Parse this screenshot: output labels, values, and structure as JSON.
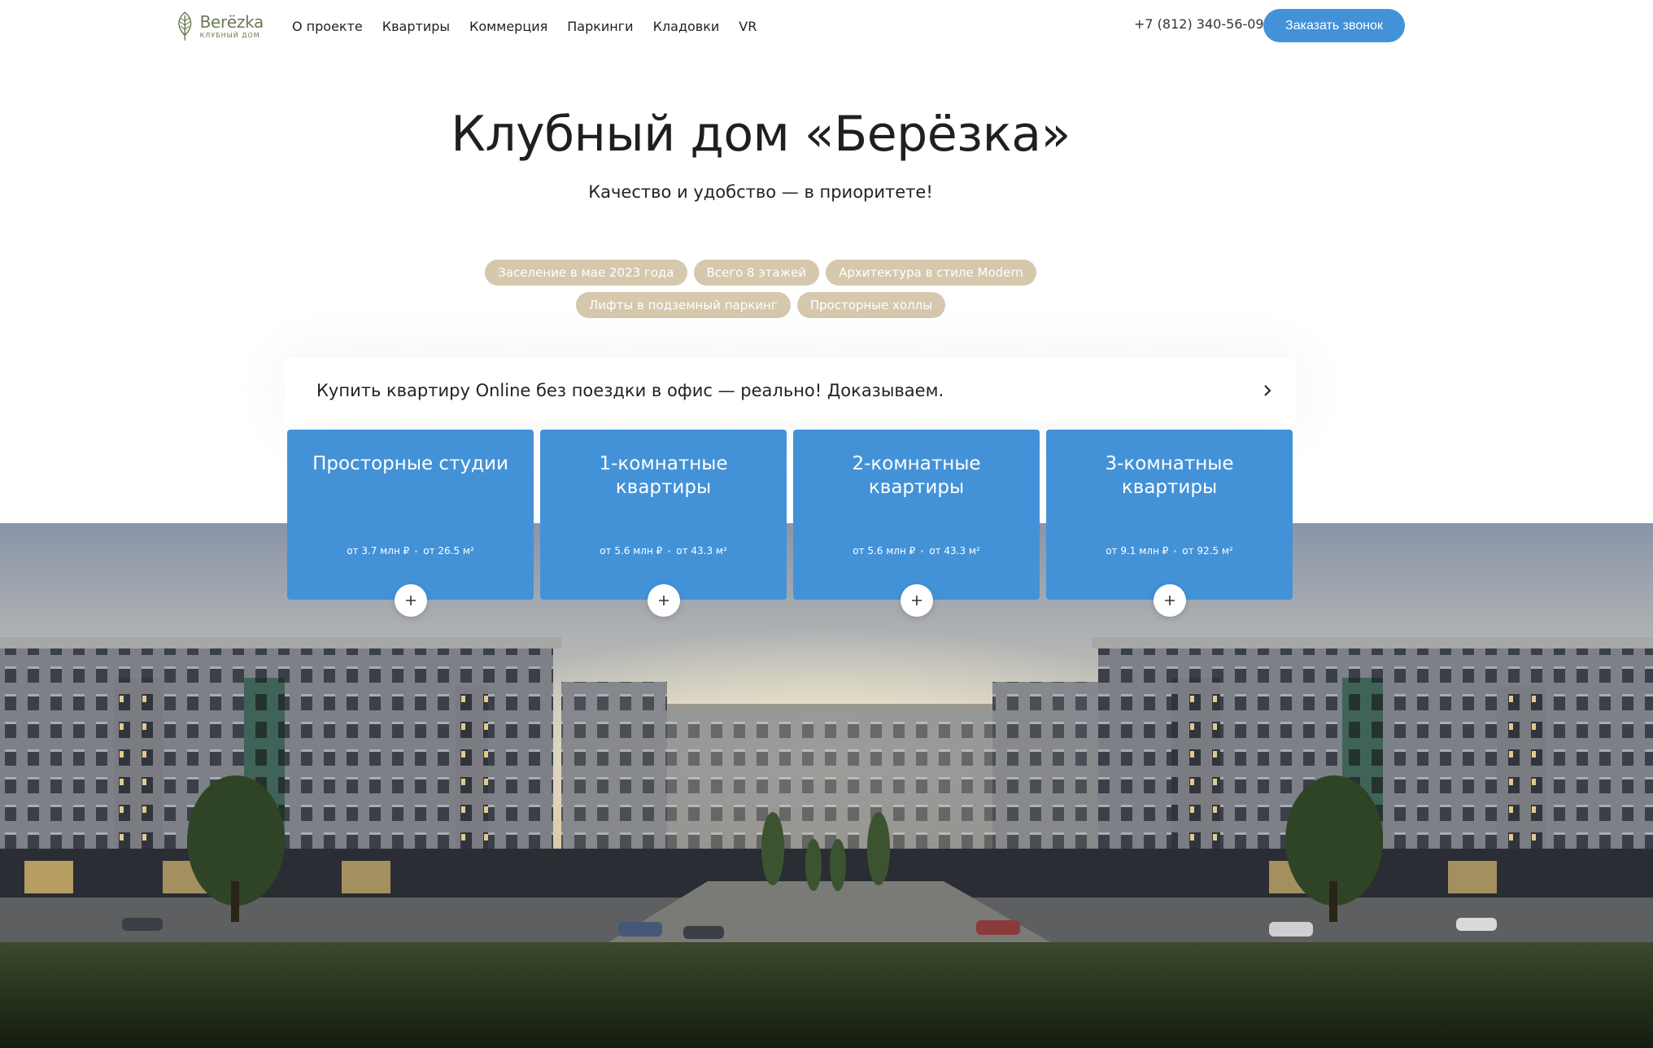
{
  "header": {
    "logo_name": "Berёzka",
    "logo_sub": "КЛУБНЫЙ ДОМ",
    "nav": [
      "О проекте",
      "Квартиры",
      "Коммерция",
      "Паркинги",
      "Кладовки",
      "VR"
    ],
    "phone": "+7 (812) 340-56-09",
    "cta_label": "Заказать звонок"
  },
  "hero": {
    "title": "Клубный дом «Берёзка»",
    "subtitle": "Качество и удобство — в приоритете!"
  },
  "tags_row1": [
    "Заселение в мае 2023 года",
    "Всего 8 этажей",
    "Архитектура в стиле Modern"
  ],
  "tags_row2": [
    "Лифты в подземный паркинг",
    "Просторные холлы"
  ],
  "banner": {
    "text": "Купить квартиру Online без поездки в офис — реально! Доказываем."
  },
  "cards": [
    {
      "title": "Просторные студии",
      "price": "от 3.7 млн ₽",
      "area": "от 26.5 м²"
    },
    {
      "title": "1-комнатные квартиры",
      "price": "от 5.6 млн ₽",
      "area": "от 43.3 м²"
    },
    {
      "title": "2-комнатные квартиры",
      "price": "от 5.6 млн ₽",
      "area": "от 43.3 м²"
    },
    {
      "title": "3-комнатные квартиры",
      "price": "от 9.1 млн ₽",
      "area": "от 92.5 м²"
    }
  ],
  "colors": {
    "accent": "#4392d8",
    "tag": "#d5c8ad",
    "logo": "#6b7a55"
  },
  "icons": {
    "logo": "leaf-icon",
    "banner": "chevron-right-icon",
    "card_toggle": "plus-icon"
  }
}
